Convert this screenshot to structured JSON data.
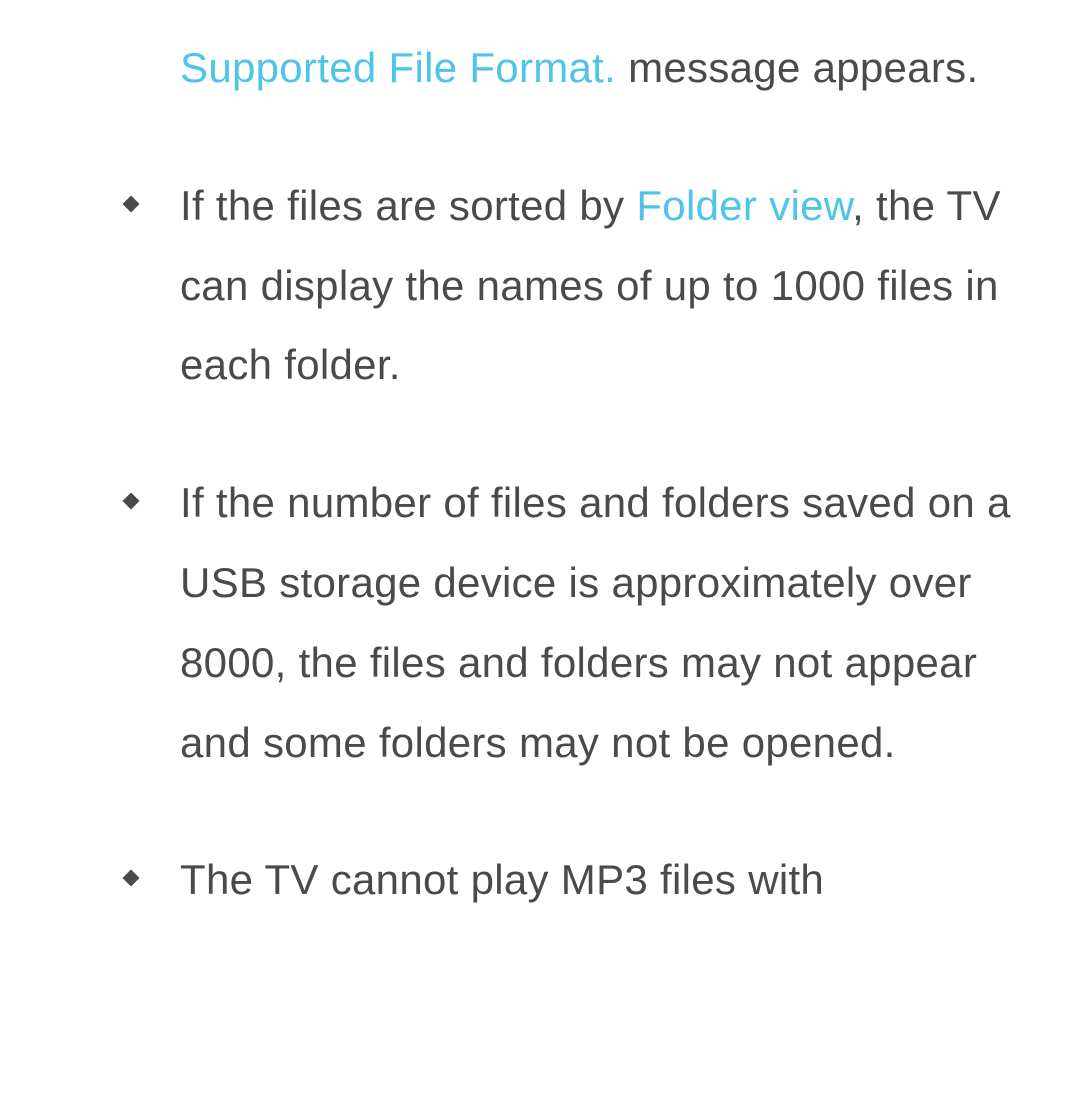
{
  "fragment": {
    "highlight": "Supported File Format.",
    "rest": " message appears."
  },
  "items": [
    {
      "prefix": "If the files are sorted by ",
      "highlight": "Folder view",
      "suffix": ", the TV can display the names of up to 1000 files in each folder."
    },
    {
      "text": "If the number of files and folders saved on a USB storage device is approximately over 8000, the files and folders may not appear and some folders may not be opened."
    },
    {
      "text": "The TV cannot play MP3 files with"
    }
  ]
}
